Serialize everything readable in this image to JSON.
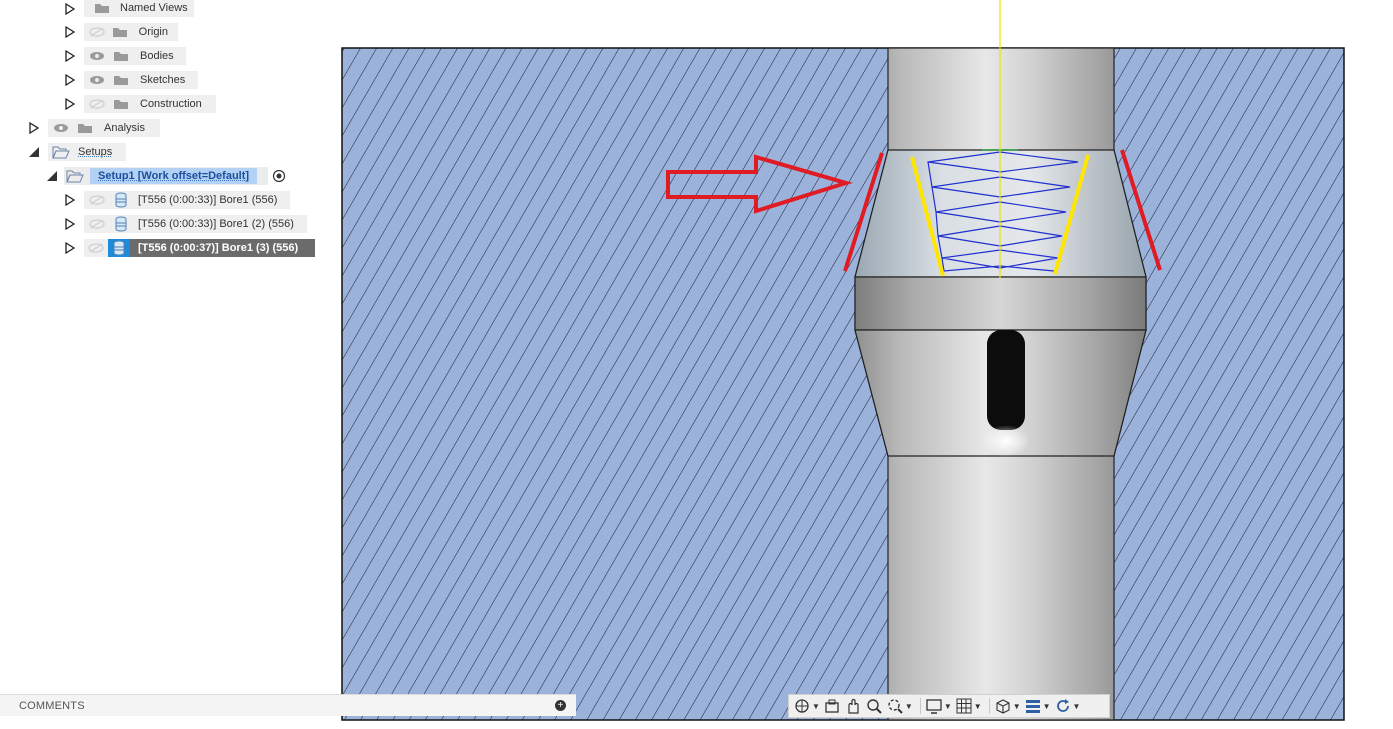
{
  "browser_tree": {
    "items": [
      {
        "label": "Named Views",
        "visible": true
      },
      {
        "label": "Origin",
        "visible": false
      },
      {
        "label": "Bodies",
        "visible": true
      },
      {
        "label": "Sketches",
        "visible": true
      },
      {
        "label": "Construction",
        "visible": false
      },
      {
        "label": "Analysis",
        "visible": true
      },
      {
        "label": "Setups"
      },
      {
        "label": "Setup1 [Work offset=Default]"
      },
      {
        "label": "[T556 (0:00:33)] Bore1 (556)"
      },
      {
        "label": "[T556 (0:00:33)] Bore1 (2) (556)"
      },
      {
        "label": "[T556 (0:00:37)] Bore1 (3) (556)"
      }
    ]
  },
  "comments": {
    "label": "COMMENTS"
  },
  "navbar": {
    "tools": [
      "orbit-icon",
      "look-at-icon",
      "pan-icon",
      "zoom-icon",
      "fit-icon",
      "display-settings-icon",
      "grid-icon",
      "view-cube-icon",
      "section-icon",
      "refresh-icon"
    ]
  },
  "colors": {
    "hatch_fill": "#9bb2da",
    "hatch_line": "#1a1a2e",
    "annotation_red": "#e01b24",
    "annotation_yellow": "#ffe600",
    "helix_blue": "#1f2fd0",
    "selection_blue": "#b3d1f5"
  }
}
